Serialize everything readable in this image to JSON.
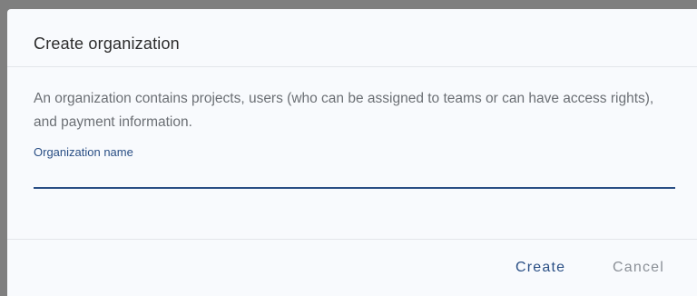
{
  "dialog": {
    "title": "Create organization",
    "description": "An organization contains projects, users (who can be assigned to teams or can have access rights), and payment information.",
    "field": {
      "label": "Organization name",
      "value": "",
      "placeholder": ""
    },
    "buttons": {
      "create_label": "Create",
      "cancel_label": "Cancel"
    }
  },
  "colors": {
    "accent": "#2a4f85",
    "dialog_background": "#f8fafd",
    "backdrop": "#7f7f7f",
    "muted_text": "#6b6f74"
  }
}
